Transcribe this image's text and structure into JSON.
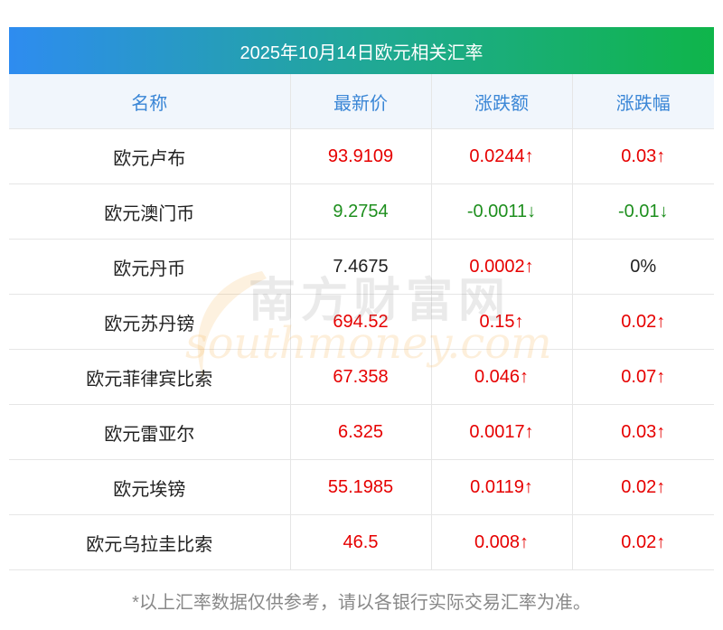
{
  "title": "2025年10月14日欧元相关汇率",
  "headers": [
    "名称",
    "最新价",
    "涨跌额",
    "涨跌幅"
  ],
  "rows": [
    {
      "name": "欧元卢布",
      "price": "93.9109",
      "change": "0.0244↑",
      "pct": "0.03↑",
      "trend": "up"
    },
    {
      "name": "欧元澳门币",
      "price": "9.2754",
      "change": "-0.0011↓",
      "pct": "-0.01↓",
      "trend": "down"
    },
    {
      "name": "欧元丹币",
      "price": "7.4675",
      "change": "0.0002↑",
      "pct": "0%",
      "trend": "flat-price"
    },
    {
      "name": "欧元苏丹镑",
      "price": "694.52",
      "change": "0.15↑",
      "pct": "0.02↑",
      "trend": "up"
    },
    {
      "name": "欧元菲律宾比索",
      "price": "67.358",
      "change": "0.046↑",
      "pct": "0.07↑",
      "trend": "up"
    },
    {
      "name": "欧元雷亚尔",
      "price": "6.325",
      "change": "0.0017↑",
      "pct": "0.03↑",
      "trend": "up"
    },
    {
      "name": "欧元埃镑",
      "price": "55.1985",
      "change": "0.0119↑",
      "pct": "0.02↑",
      "trend": "up"
    },
    {
      "name": "欧元乌拉圭比索",
      "price": "46.5",
      "change": "0.008↑",
      "pct": "0.02↑",
      "trend": "up"
    }
  ],
  "footnote": "*以上汇率数据仅供参考，请以各银行实际交易汇率为准。",
  "watermark": {
    "cn": "南方财富网",
    "en": "southmoney.com"
  },
  "colors": {
    "up": "#e60000",
    "down": "#1e8f1e",
    "header_text": "#3a86d6",
    "title_start": "#2e8cf0",
    "title_end": "#0fb54a"
  }
}
